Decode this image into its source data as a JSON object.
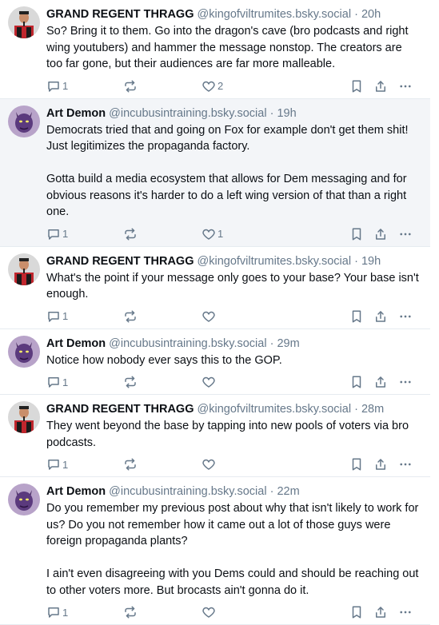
{
  "posts": [
    {
      "author": "GRAND REGENT THRAGG",
      "handle": "@kingofviltrumites.bsky.social",
      "dot": "·",
      "time": "20h",
      "text": "So? Bring it to them. Go into the dragon's cave (bro podcasts and right wing youtubers) and hammer the message nonstop. The creators are too far gone, but their audiences are far more malleable.",
      "avatar": "thragg",
      "reply_count": "1",
      "repost_count": "",
      "like_count": "2",
      "highlight": false
    },
    {
      "author": "Art Demon",
      "handle": "@incubusintraining.bsky.social",
      "dot": "·",
      "time": "19h",
      "text": "Democrats tried that and going on Fox for example don't get them shit! Just legitimizes the propaganda factory.\n\nGotta build a media ecosystem that allows for Dem messaging and for obvious reasons it's harder to do a left wing version of that than a right one.",
      "avatar": "demon",
      "reply_count": "1",
      "repost_count": "",
      "like_count": "1",
      "highlight": true
    },
    {
      "author": "GRAND REGENT THRAGG",
      "handle": "@kingofviltrumites.bsky.social",
      "dot": "·",
      "time": "19h",
      "text": "What's the point if your message only goes to your base? Your base isn't enough.",
      "avatar": "thragg",
      "reply_count": "1",
      "repost_count": "",
      "like_count": "",
      "highlight": false
    },
    {
      "author": "Art Demon",
      "handle": "@incubusintraining.bsky.social",
      "dot": "·",
      "time": "29m",
      "text": "Notice how nobody ever says this to the GOP.",
      "avatar": "demon",
      "reply_count": "1",
      "repost_count": "",
      "like_count": "",
      "highlight": false
    },
    {
      "author": "GRAND REGENT THRAGG",
      "handle": "@kingofviltrumites.bsky.social",
      "dot": "·",
      "time": "28m",
      "text": "They went beyond the base by tapping into new pools of voters via bro podcasts.",
      "avatar": "thragg",
      "reply_count": "1",
      "repost_count": "",
      "like_count": "",
      "highlight": false
    },
    {
      "author": "Art Demon",
      "handle": "@incubusintraining.bsky.social",
      "dot": "·",
      "time": "22m",
      "text": "Do you remember my previous post about why that isn't likely to work for us? Do you not remember how it came out a lot of those guys were foreign propaganda plants?\n\nI ain't even disagreeing with you Dems could and should be reaching out to other voters more. But brocasts ain't gonna do it.",
      "avatar": "demon",
      "reply_count": "1",
      "repost_count": "",
      "like_count": "",
      "highlight": false
    }
  ],
  "colors": {
    "text": "#0b0f14",
    "muted": "#66788a",
    "highlight_bg": "#f3f5f8",
    "divider": "#e6ebf0"
  },
  "icons": {
    "reply": "speech-bubble-icon",
    "repost": "repost-arrows-icon",
    "like": "heart-icon",
    "bookmark": "bookmark-icon",
    "share": "share-icon",
    "more": "more-dots-icon"
  }
}
